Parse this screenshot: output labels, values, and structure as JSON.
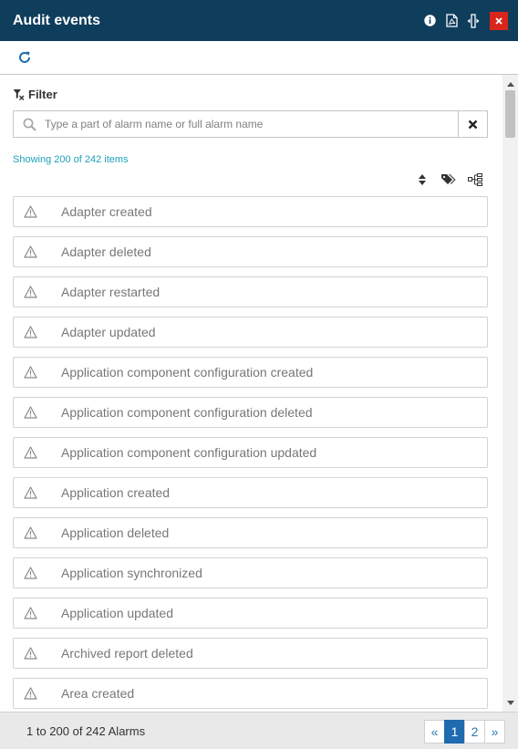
{
  "window": {
    "title": "Audit events",
    "icons": [
      "info-icon",
      "pdf-icon",
      "resize-columns-icon",
      "close-icon"
    ]
  },
  "toolbar": {
    "refresh_icon": "refresh-icon"
  },
  "filter": {
    "label": "Filter",
    "placeholder": "Type a part of alarm name or full alarm name",
    "value": ""
  },
  "status": {
    "showing": "Showing 200 of 242 items"
  },
  "list_tools": [
    "sort-icon",
    "tags-icon",
    "tree-icon"
  ],
  "items": [
    {
      "label": "Adapter created"
    },
    {
      "label": "Adapter deleted"
    },
    {
      "label": "Adapter restarted"
    },
    {
      "label": "Adapter updated"
    },
    {
      "label": "Application component configuration created"
    },
    {
      "label": "Application component configuration deleted"
    },
    {
      "label": "Application component configuration updated"
    },
    {
      "label": "Application created"
    },
    {
      "label": "Application deleted"
    },
    {
      "label": "Application synchronized"
    },
    {
      "label": "Application updated"
    },
    {
      "label": "Archived report deleted"
    },
    {
      "label": "Area created"
    }
  ],
  "footer": {
    "summary": "1 to 200 of 242 Alarms",
    "pager": {
      "prev": "«",
      "pages": [
        "1",
        "2"
      ],
      "current": "1",
      "next": "»"
    }
  },
  "colors": {
    "titlebar": "#0f3d5c",
    "close": "#d9261c",
    "accent": "#1f6bb0",
    "count_text": "#1fa1b8"
  }
}
